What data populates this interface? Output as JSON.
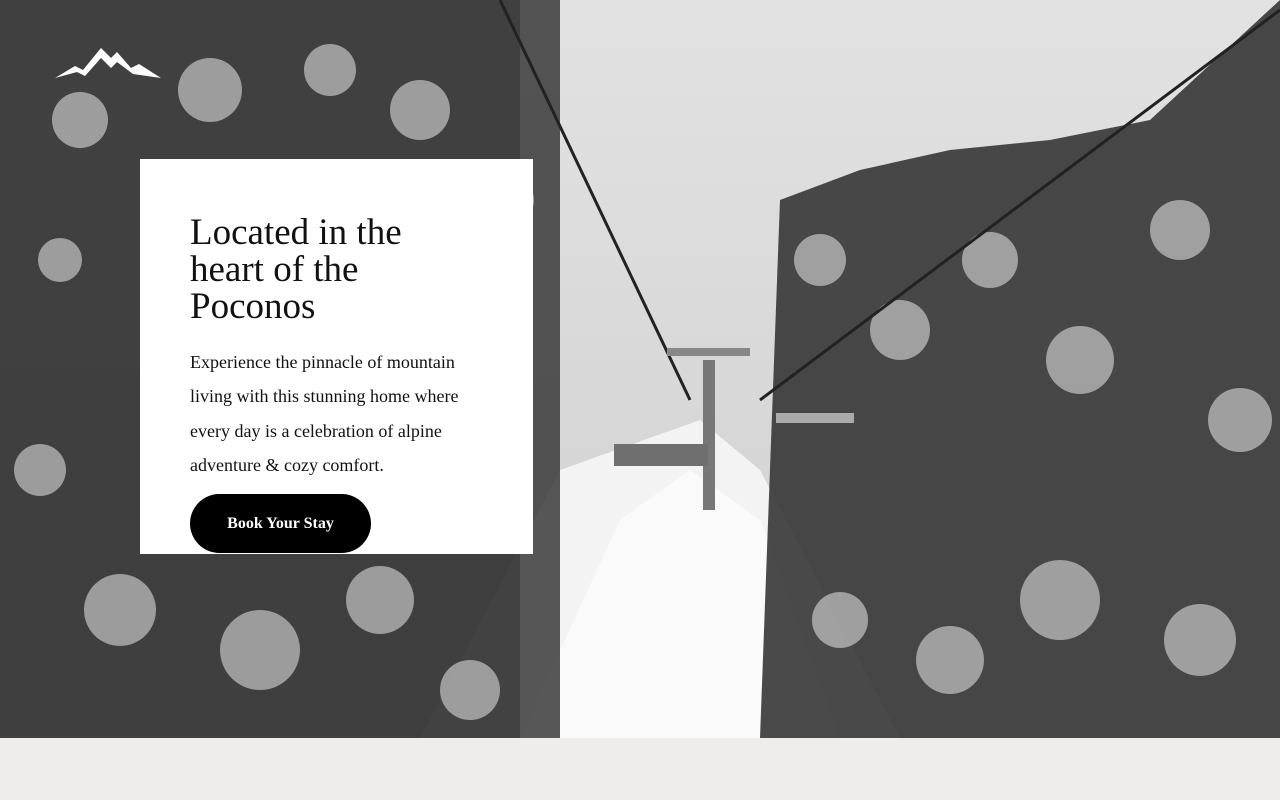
{
  "brand": {
    "logo_icon": "mountain-logo-icon"
  },
  "hero": {
    "heading": "Located in the heart of the Poconos",
    "body": "Experience the pinnacle of mountain living with this stunning home where every day is a celebration of alpine adventure & cozy comfort.",
    "cta_label": "Book Your Stay",
    "background_image": "snowy-forest-ski-lift-photo"
  },
  "colors": {
    "card_background": "#ffffff",
    "button_background": "#000000",
    "button_text": "#ffffff",
    "page_background": "#eeedeb"
  }
}
